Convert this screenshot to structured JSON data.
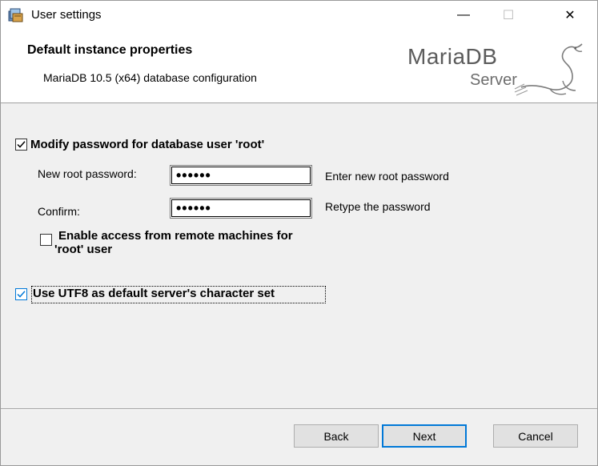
{
  "window": {
    "title": "User settings",
    "controls": {
      "minimize": "—",
      "maximize": "☐",
      "close": "✕"
    }
  },
  "banner": {
    "title": "Default instance properties",
    "subtitle": "MariaDB 10.5 (x64) database configuration",
    "logo_text_main": "MariaDB",
    "logo_text_sub": "Server"
  },
  "options": {
    "modify_password": {
      "label": "Modify password for database user 'root'",
      "checked": true
    },
    "new_password": {
      "label": "New root password:",
      "value": "••••••",
      "hint": "Enter new root password"
    },
    "confirm_password": {
      "label": "Confirm:",
      "value": "••••••",
      "hint": "Retype the password"
    },
    "remote_access": {
      "label_line1": "Enable access from remote machines for",
      "label_line2": "'root' user",
      "checked": false
    },
    "utf8": {
      "label": "Use UTF8 as default server's character set",
      "checked": true
    }
  },
  "buttons": {
    "back": "Back",
    "next": "Next",
    "cancel": "Cancel"
  },
  "colors": {
    "accent": "#0078d7",
    "dialog_bg": "#f0f0f0",
    "button_bg": "#e1e1e1"
  }
}
